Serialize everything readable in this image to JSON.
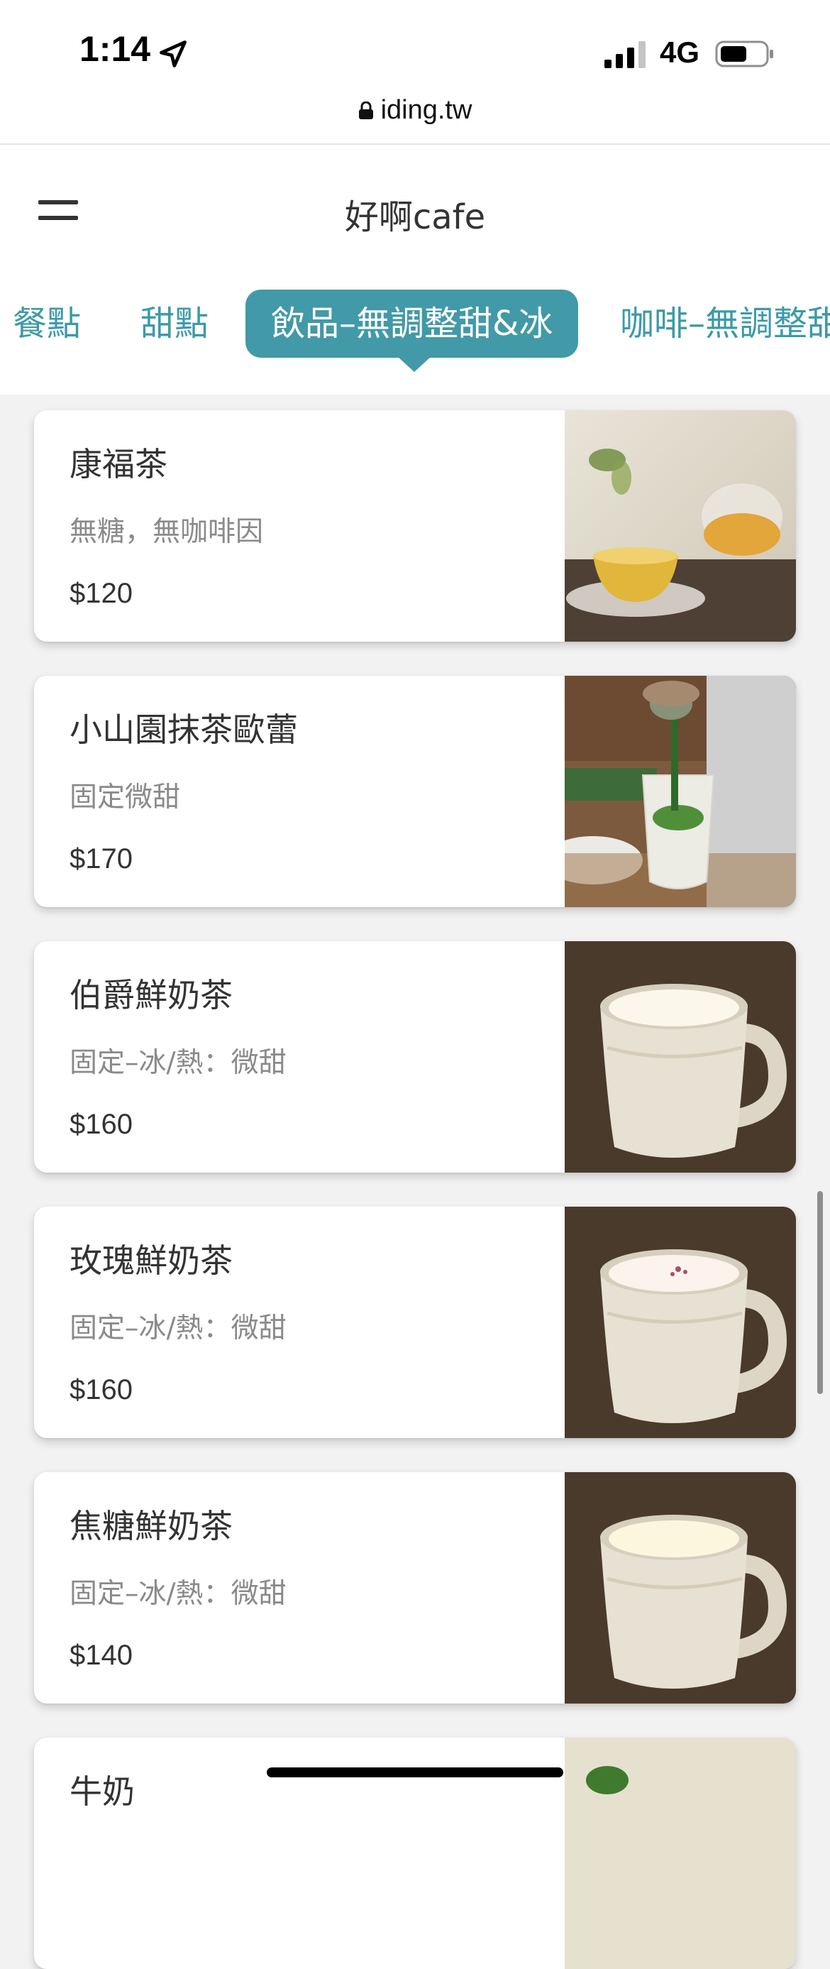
{
  "status_bar": {
    "time": "1:14",
    "network": "4G"
  },
  "browser": {
    "url": "iding.tw"
  },
  "header": {
    "title": "好啊cafe"
  },
  "tabs": [
    {
      "label": "餐點",
      "active": false
    },
    {
      "label": "甜點",
      "active": false
    },
    {
      "label": "飲品–無調整甜&冰",
      "active": true
    },
    {
      "label": "咖啡–無調整甜",
      "active": false
    }
  ],
  "items": [
    {
      "name": "康福茶",
      "desc": "無糖，無咖啡因",
      "price": "$120",
      "photo": "herbal-tea"
    },
    {
      "name": "小山園抹茶歐蕾",
      "desc": "固定微甜",
      "price": "$170",
      "photo": "matcha-latte"
    },
    {
      "name": "伯爵鮮奶茶",
      "desc": "固定–冰/熱：微甜",
      "price": "$160",
      "photo": "milk-tea-mug"
    },
    {
      "name": "玫瑰鮮奶茶",
      "desc": "固定–冰/熱：微甜",
      "price": "$160",
      "photo": "milk-tea-mug"
    },
    {
      "name": "焦糖鮮奶茶",
      "desc": "固定–冰/熱：微甜",
      "price": "$140",
      "photo": "milk-tea-mug"
    },
    {
      "name": "牛奶",
      "desc": "",
      "price": "",
      "photo": "partial"
    }
  ],
  "colors": {
    "accent": "#4299a8",
    "tab_text": "#3c9aa8",
    "background": "#f2f2f2"
  }
}
